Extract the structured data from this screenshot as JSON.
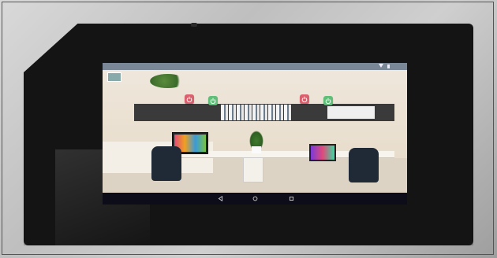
{
  "statusbar": {
    "app_title": "",
    "time": ""
  },
  "scene": {
    "buttons": [
      {
        "name": "light-1-off",
        "state": "off",
        "color": "#d9606c"
      },
      {
        "name": "light-1-on",
        "state": "on",
        "color": "#5fbf78"
      },
      {
        "name": "light-2-off",
        "state": "off",
        "color": "#d9606c"
      },
      {
        "name": "light-2-on",
        "state": "on",
        "color": "#5fbf78"
      }
    ]
  },
  "navbar": {
    "icons": [
      "back-icon",
      "home-icon",
      "recents-icon"
    ]
  },
  "colors": {
    "tablet": "#141414",
    "statusbar": "#7a8796",
    "navbar": "#0d0d1a"
  }
}
